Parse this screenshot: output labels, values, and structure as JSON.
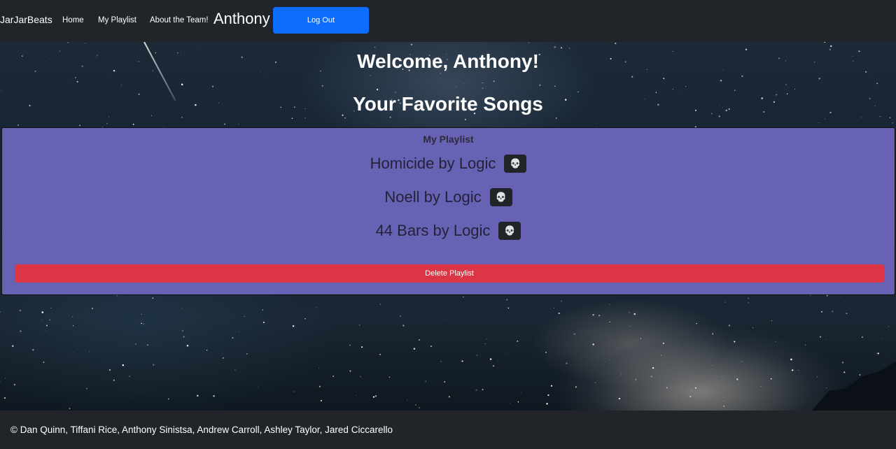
{
  "navbar": {
    "brand": "JarJarBeats",
    "links": [
      {
        "label": "Home"
      },
      {
        "label": "My Playlist"
      },
      {
        "label": "About the Team!"
      }
    ],
    "user_name": "Anthony",
    "logout_label": "Log Out"
  },
  "main": {
    "welcome": "Welcome, Anthony!",
    "favorites_title": "Your Favorite Songs",
    "playlist": {
      "heading": "My Playlist",
      "songs": [
        {
          "label": "Homicide by Logic",
          "button_icon": "skull-icon"
        },
        {
          "label": "Noell by Logic",
          "button_icon": "skull-icon"
        },
        {
          "label": "44 Bars by Logic",
          "button_icon": "skull-icon"
        }
      ],
      "delete_label": "Delete Playlist"
    }
  },
  "footer": {
    "text": "© Dan Quinn, Tiffani Rice, Anthony Sinistsa, Andrew Carroll, Ashley Taylor, Jared Ciccarello"
  },
  "colors": {
    "navbar_bg": "#212529",
    "logout_button": "#0d6efd",
    "playlist_card": "#6762b3",
    "delete_button": "#dc3545",
    "skull_button": "#212529"
  }
}
